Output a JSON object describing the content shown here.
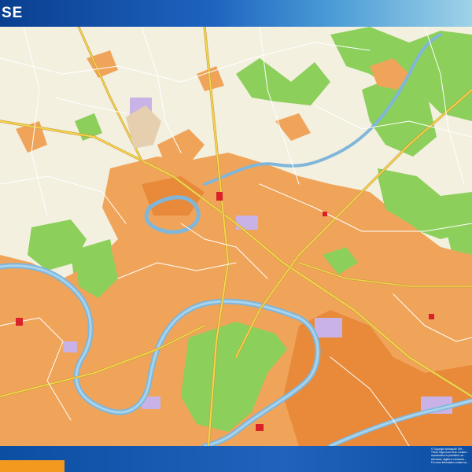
{
  "title": "SE",
  "colors": {
    "frame": "#0b4ea2",
    "land": "#f3f0e0",
    "urban": "#f0a45a",
    "urban_dark": "#e88a3a",
    "forest": "#8ccf5a",
    "forest_dark": "#6fbf43",
    "river": "#7fb6d9",
    "river_fill": "#a9d3ec",
    "road_major": "#f7d54a",
    "road_minor": "#ffffff",
    "road_outline": "#c49a40",
    "special": "#c9b3e6",
    "landmark": "#d9222a",
    "logo": "#f39a1e"
  },
  "copyright": {
    "lines": [
      "© Copyright Netmaps® 199…",
      "These maps have been created…",
      "reproduction is prohibited, as…",
      "electronic, digital or mechanic…",
      "For more information contact us…"
    ]
  }
}
